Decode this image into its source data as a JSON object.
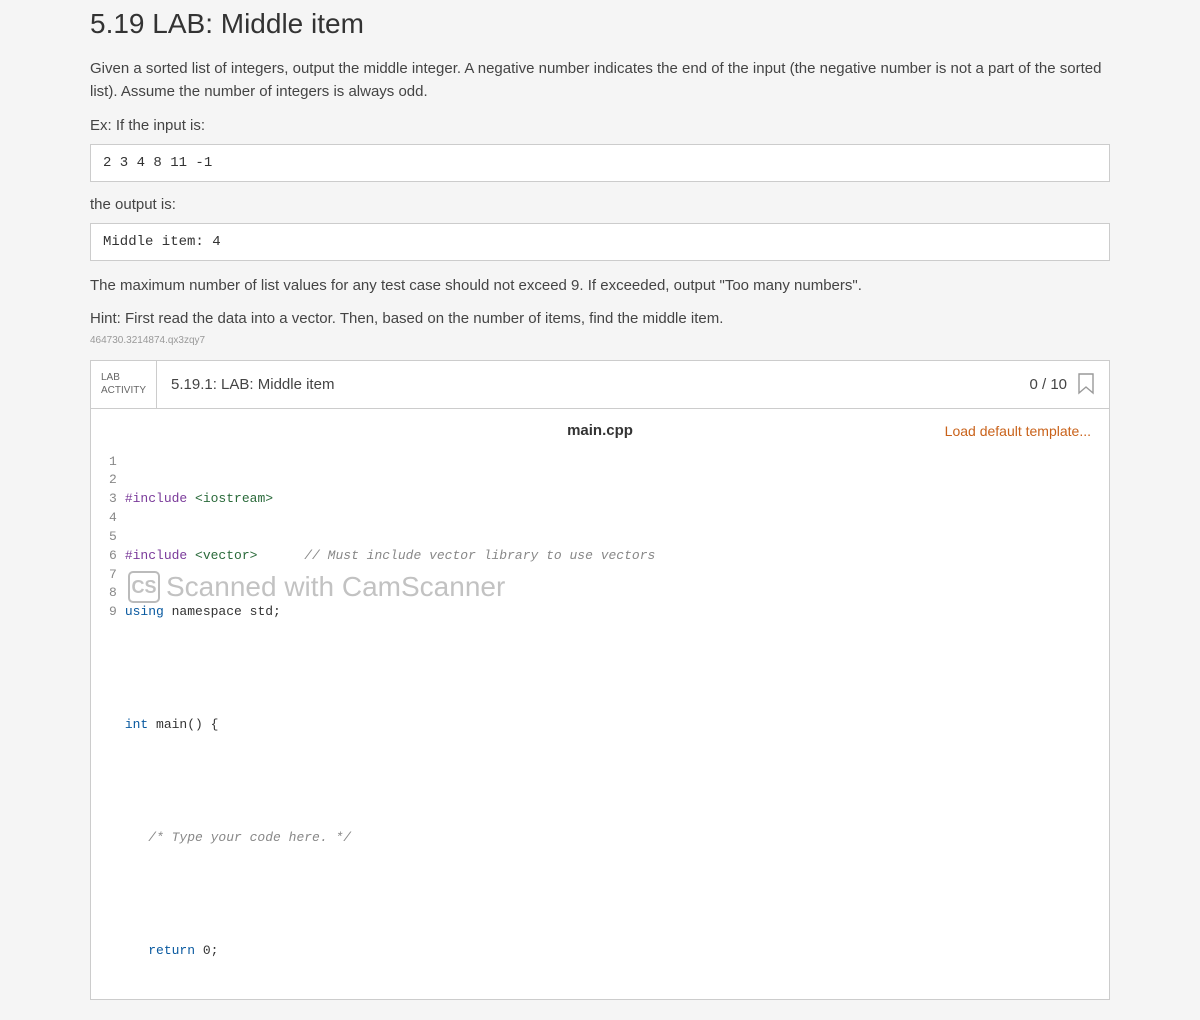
{
  "title": "5.19 LAB: Middle item",
  "description": "Given a sorted list of integers, output the middle integer. A negative number indicates the end of the input (the negative number is not a part of the sorted list). Assume the number of integers is always odd.",
  "ex_label": "Ex: If the input is:",
  "input_example": "2 3 4 8 11 -1",
  "output_label": "the output is:",
  "output_example": "Middle item: 4",
  "note": "The maximum number of list values for any test case should not exceed 9. If exceeded, output \"Too many numbers\".",
  "hint": "Hint: First read the data into a vector. Then, based on the number of items, find the middle item.",
  "tiny_id": "464730.3214874.qx3zqy7",
  "activity": {
    "tag_line1": "LAB",
    "tag_line2": "ACTIVITY",
    "title": "5.19.1: LAB: Middle item",
    "score": "0 / 10"
  },
  "editor": {
    "filename": "main.cpp",
    "load_template": "Load default template..."
  },
  "code_lines": {
    "l1_a": "#include ",
    "l1_b": "<iostream>",
    "l2_a": "#include ",
    "l2_b": "<vector>",
    "l2_c": "      // Must include vector library to use vectors",
    "l3_a": "using",
    "l3_b": " namespace std;",
    "l4": "",
    "l5_a": "int",
    "l5_b": " main() {",
    "l6": "",
    "l7": "   /* Type your code here. */",
    "l8": "",
    "l9_a": "   ",
    "l9_b": "return",
    "l9_c": " 0;"
  },
  "watermark": "Scanned with CamScanner",
  "watermark_badge": "CS"
}
